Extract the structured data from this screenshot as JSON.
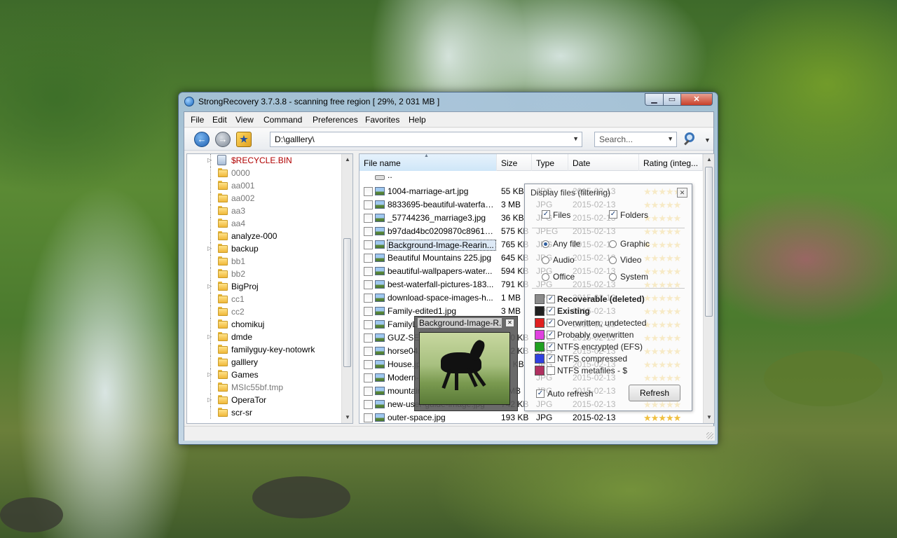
{
  "window": {
    "title": "StrongRecovery 3.7.3.8 - scanning free region [ 29%, 2 031 MB ]",
    "min_icon": "minimize-icon",
    "max_icon": "maximize-icon",
    "close_icon": "close-icon"
  },
  "menu": [
    "File",
    "Edit",
    "View",
    "Command",
    "Preferences",
    "Favorites",
    "Help"
  ],
  "toolbar": {
    "path": "D:\\galllery\\",
    "search_placeholder": "Search..."
  },
  "tree": {
    "items": [
      {
        "label": "$RECYCLE.BIN",
        "style": "red",
        "expander": true,
        "icon": "recycle-bin-icon"
      },
      {
        "label": "0000",
        "style": "gray",
        "expander": false
      },
      {
        "label": "aa001",
        "style": "gray",
        "expander": false
      },
      {
        "label": "aa002",
        "style": "gray",
        "expander": false
      },
      {
        "label": "aa3",
        "style": "gray",
        "expander": false
      },
      {
        "label": "aa4",
        "style": "gray",
        "expander": false
      },
      {
        "label": "analyze-000",
        "style": "normal",
        "expander": false
      },
      {
        "label": "backup",
        "style": "normal",
        "expander": true
      },
      {
        "label": "bb1",
        "style": "gray",
        "expander": false
      },
      {
        "label": "bb2",
        "style": "gray",
        "expander": false
      },
      {
        "label": "BigProj",
        "style": "normal",
        "expander": true
      },
      {
        "label": "cc1",
        "style": "gray",
        "expander": false
      },
      {
        "label": "cc2",
        "style": "gray",
        "expander": false
      },
      {
        "label": "chomikuj",
        "style": "normal",
        "expander": false
      },
      {
        "label": "dmde",
        "style": "normal",
        "expander": true
      },
      {
        "label": "familyguy-key-notowrk",
        "style": "normal",
        "expander": false
      },
      {
        "label": "galllery",
        "style": "normal",
        "expander": false
      },
      {
        "label": "Games",
        "style": "normal",
        "expander": true
      },
      {
        "label": "MSIc55bf.tmp",
        "style": "gray",
        "expander": false
      },
      {
        "label": "OperaTor",
        "style": "normal",
        "expander": true
      },
      {
        "label": "scr-sr",
        "style": "normal",
        "expander": false
      }
    ]
  },
  "columns": {
    "name": "File name",
    "size": "Size",
    "type": "Type",
    "date": "Date",
    "rating": "Rating (integ..."
  },
  "files": [
    {
      "name": "..",
      "size": "",
      "type": "",
      "date": "",
      "stars": 0,
      "updir": true
    },
    {
      "name": "1004-marriage-art.jpg",
      "size": "55 KB",
      "type": "JPG",
      "date": "2015-02-13",
      "stars": 5
    },
    {
      "name": "8833695-beautiful-waterfall...",
      "size": "3 MB",
      "type": "JPG",
      "date": "2015-02-13",
      "stars": 5
    },
    {
      "name": "_57744236_marriage3.jpg",
      "size": "36 KB",
      "type": "JPG",
      "date": "2015-02-13",
      "stars": 5
    },
    {
      "name": "b97dad4bc0209870c896143...",
      "size": "575 KB",
      "type": "JPEG",
      "date": "2015-02-13",
      "stars": 5
    },
    {
      "name": "Background-Image-Rearin...",
      "size": "765 KB",
      "type": "JPG",
      "date": "2015-02-13",
      "stars": 5,
      "selected": true
    },
    {
      "name": "Beautiful Mountains 225.jpg",
      "size": "645 KB",
      "type": "JPG",
      "date": "2015-02-13",
      "stars": 5
    },
    {
      "name": "beautiful-wallpapers-water...",
      "size": "594 KB",
      "type": "JPG",
      "date": "2015-02-13",
      "stars": 5
    },
    {
      "name": "best-waterfall-pictures-183...",
      "size": "791 KB",
      "type": "JPG",
      "date": "2015-02-13",
      "stars": 5
    },
    {
      "name": "download-space-images-h...",
      "size": "1 MB",
      "type": "JPG",
      "date": "2015-02-13",
      "stars": 5
    },
    {
      "name": "Family-edited1.jpg",
      "size": "3 MB",
      "type": "JPG",
      "date": "2015-02-13",
      "stars": 5
    },
    {
      "name": "FamilyLaw.jpg",
      "size": "",
      "type": "JPG",
      "date": "2015-02-13",
      "stars": 5
    },
    {
      "name": "GUZ-SENTOSA-014.jpg",
      "size": "220 KB",
      "type": "JPG",
      "date": "2015-02-13",
      "stars": 5
    },
    {
      "name": "horse04.jpg",
      "size": "102 KB",
      "type": "JPG",
      "date": "2015-02-13",
      "stars": 5
    },
    {
      "name": "House.jpg",
      "size": "40 KB",
      "type": "JPG",
      "date": "2015-02-13",
      "stars": 5
    },
    {
      "name": "Modern-A-House-17.jpg",
      "size": "",
      "type": "JPG",
      "date": "2015-02-13",
      "stars": 5
    },
    {
      "name": "mountains-sunshine.jpg",
      "size": "1 MB",
      "type": "JPG",
      "date": "2015-02-13",
      "stars": 5
    },
    {
      "name": "new-user-guide-image.jpg",
      "size": "742 KB",
      "type": "JPG",
      "date": "2015-02-13",
      "stars": 5
    },
    {
      "name": "outer-space.jpg",
      "size": "193 KB",
      "type": "JPG",
      "date": "2015-02-13",
      "stars": 5
    }
  ],
  "filter": {
    "title": "Display files (filtering)",
    "files_label": "Files",
    "folders_label": "Folders",
    "files_checked": true,
    "folders_checked": true,
    "types": [
      {
        "label": "Any file",
        "selected": true
      },
      {
        "label": "Graphic",
        "selected": false
      },
      {
        "label": "Audio",
        "selected": false
      },
      {
        "label": "Video",
        "selected": false
      },
      {
        "label": "Office",
        "selected": false
      },
      {
        "label": "System",
        "selected": false
      }
    ],
    "states": [
      {
        "label": "Recoverable (deleted)",
        "color": "#8a8a8a",
        "checked": true,
        "bold": true
      },
      {
        "label": "Existing",
        "color": "#202020",
        "checked": true,
        "bold": true
      },
      {
        "label": "Overwritten, undetected",
        "color": "#e02020",
        "checked": true,
        "bold": false
      },
      {
        "label": "Probably overwritten",
        "color": "#e040e0",
        "checked": true,
        "bold": false
      },
      {
        "label": "NTFS encrypted (EFS)",
        "color": "#20a020",
        "checked": true,
        "bold": false
      },
      {
        "label": "NTFS compressed",
        "color": "#3040e0",
        "checked": true,
        "bold": false
      },
      {
        "label": "NTFS metafiles - $",
        "color": "#b03060",
        "checked": false,
        "bold": false
      }
    ],
    "auto_refresh_label": "Auto refresh",
    "auto_refresh_checked": true,
    "refresh_label": "Refresh"
  },
  "preview": {
    "title": "Background-Image-R..."
  }
}
